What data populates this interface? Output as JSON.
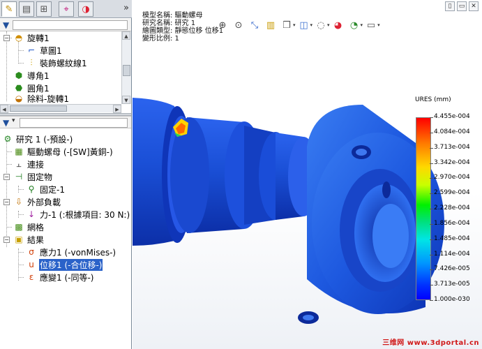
{
  "panel_tabs": [
    {
      "icon": "feature-manager-icon"
    },
    {
      "icon": "property-manager-icon"
    },
    {
      "icon": "configuration-manager-icon"
    },
    {
      "icon": "dimxpert-icon"
    },
    {
      "icon": "appearance-icon"
    }
  ],
  "top_tree": [
    {
      "label": "旋轉1",
      "icon": "revolve-icon"
    },
    {
      "label": "草圖1",
      "icon": "sketch-icon"
    },
    {
      "label": "裝飾螺紋線1",
      "icon": "cosmetic-thread-icon"
    },
    {
      "label": "導角1",
      "icon": "chamfer-icon"
    },
    {
      "label": "圓角1",
      "icon": "fillet-icon"
    },
    {
      "label": "除料-旋轉1",
      "icon": "cut-revolve-icon"
    }
  ],
  "sim_tree": [
    {
      "label": "研究 1 (-預設-)",
      "icon": "study-icon"
    },
    {
      "label": "驅動螺母 (-[SW]黃銅-)",
      "icon": "part-icon"
    },
    {
      "label": "連接",
      "icon": "connections-icon"
    },
    {
      "label": "固定物",
      "icon": "fixtures-icon"
    },
    {
      "label": "固定-1",
      "icon": "fixed-icon"
    },
    {
      "label": "外部負載",
      "icon": "external-loads-icon"
    },
    {
      "label": "力-1 (:根據項目: 30 N:)",
      "icon": "force-icon"
    },
    {
      "label": "網格",
      "icon": "mesh-icon"
    },
    {
      "label": "結果",
      "icon": "results-icon"
    },
    {
      "label": "應力1 (-vonMises-)",
      "icon": "stress-plot-icon"
    },
    {
      "label": "位移1 (-合位移-)",
      "icon": "displacement-plot-icon",
      "selected": true
    },
    {
      "label": "應變1 (-同等-)",
      "icon": "strain-plot-icon"
    }
  ],
  "info": {
    "line1": "模型名稱: 驅動螺母",
    "line2": "研究名稱: 研究 1",
    "line3": "繪圖類型: 靜態位移 位移1",
    "line4": "變形比例: 1"
  },
  "toolbar": [
    "zoom-to-fit-icon",
    "zoom-to-area-icon",
    "zoom-in-out-icon",
    "section-view-icon",
    "view-orientation-icon",
    "display-style-icon",
    "hide-show-icon",
    "edit-appearance-icon",
    "apply-scene-icon",
    "view-settings-icon"
  ],
  "window_buttons": [
    "▯",
    "▭",
    "✕"
  ],
  "legend": {
    "title": "URES (mm)",
    "labels": [
      "4.455e-004",
      "4.084e-004",
      "3.713e-004",
      "3.342e-004",
      "2.970e-004",
      "2.599e-004",
      "2.228e-004",
      "1.856e-004",
      "1.485e-004",
      "1.114e-004",
      "7.426e-005",
      "3.713e-005",
      "1.000e-030"
    ]
  },
  "watermark": "三维网 www.3dportal.cn",
  "colors": {
    "selection": "#2a62c9",
    "part_blue": "#1a4fd6",
    "watermark": "#d01818"
  }
}
